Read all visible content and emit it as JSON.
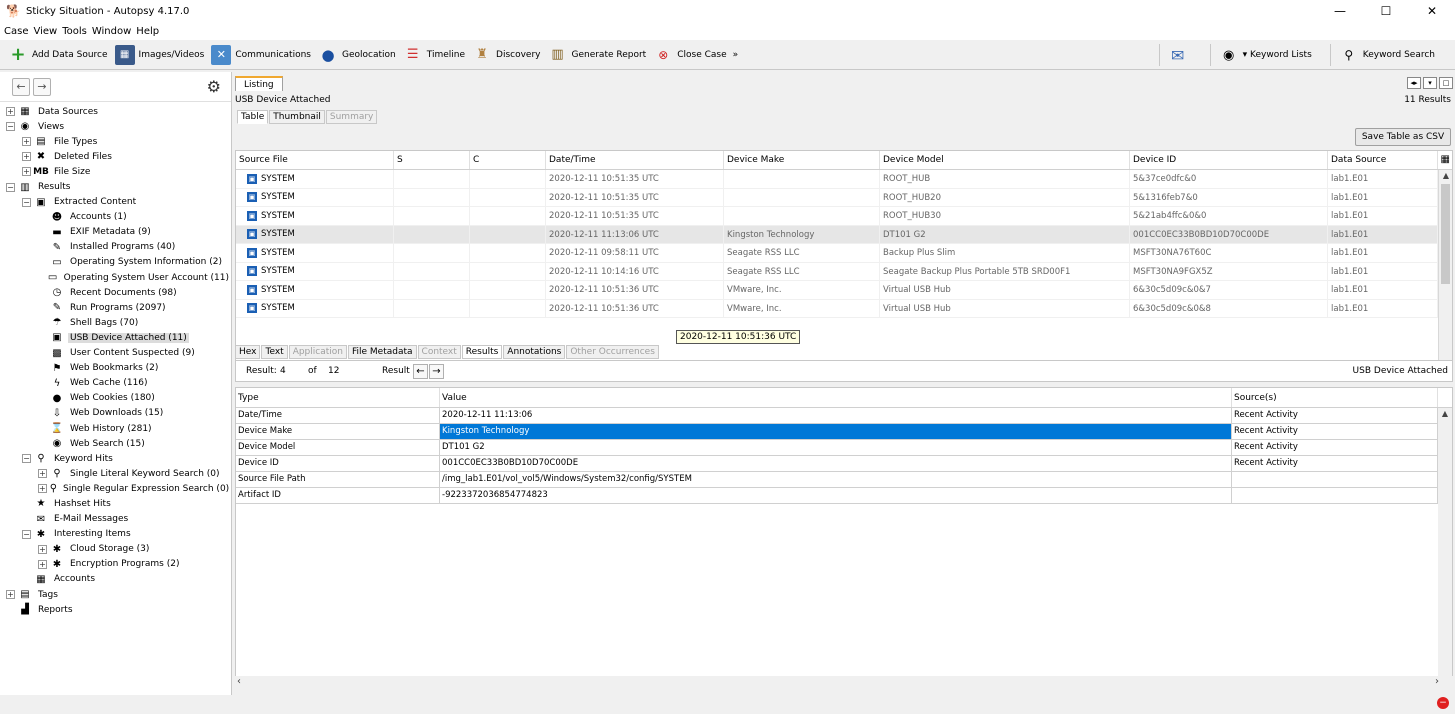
{
  "window": {
    "title": "Sticky Situation - Autopsy 4.17.0",
    "minimize": "—",
    "maximize": "☐",
    "close": "✕"
  },
  "menu": [
    "Case",
    "View",
    "Tools",
    "Window",
    "Help"
  ],
  "toolbar": {
    "add_data_source": "Add Data Source",
    "images_videos": "Images/Videos",
    "communications": "Communications",
    "geolocation": "Geolocation",
    "timeline": "Timeline",
    "discovery": "Discovery",
    "generate_report": "Generate Report",
    "close_case": "Close Case",
    "keyword_lists": "▾ Keyword Lists",
    "keyword_search": "Keyword Search"
  },
  "tree": [
    {
      "label": "Data Sources",
      "depth": 0,
      "exp": "+",
      "icon": "▦"
    },
    {
      "label": "Views",
      "depth": 0,
      "exp": "−",
      "icon": "◉"
    },
    {
      "label": "File Types",
      "depth": 1,
      "exp": "+",
      "icon": "▤"
    },
    {
      "label": "Deleted Files",
      "depth": 1,
      "exp": "+",
      "icon": "✖"
    },
    {
      "label": "File Size",
      "depth": 1,
      "exp": "+",
      "icon": "MB"
    },
    {
      "label": "Results",
      "depth": 0,
      "exp": "−",
      "icon": "▥"
    },
    {
      "label": "Extracted Content",
      "depth": 1,
      "exp": "−",
      "icon": "▣"
    },
    {
      "label": "Accounts (1)",
      "depth": 2,
      "exp": "",
      "icon": "☻"
    },
    {
      "label": "EXIF Metadata (9)",
      "depth": 2,
      "exp": "",
      "icon": "▬"
    },
    {
      "label": "Installed Programs (40)",
      "depth": 2,
      "exp": "",
      "icon": "✎"
    },
    {
      "label": "Operating System Information (2)",
      "depth": 2,
      "exp": "",
      "icon": "▭"
    },
    {
      "label": "Operating System User Account (11)",
      "depth": 2,
      "exp": "",
      "icon": "▭"
    },
    {
      "label": "Recent Documents (98)",
      "depth": 2,
      "exp": "",
      "icon": "◷"
    },
    {
      "label": "Run Programs (2097)",
      "depth": 2,
      "exp": "",
      "icon": "✎"
    },
    {
      "label": "Shell Bags (70)",
      "depth": 2,
      "exp": "",
      "icon": "☂"
    },
    {
      "label": "USB Device Attached (11)",
      "depth": 2,
      "exp": "",
      "icon": "▣",
      "selected": true
    },
    {
      "label": "User Content Suspected (9)",
      "depth": 2,
      "exp": "",
      "icon": "▩"
    },
    {
      "label": "Web Bookmarks (2)",
      "depth": 2,
      "exp": "",
      "icon": "⚑"
    },
    {
      "label": "Web Cache (116)",
      "depth": 2,
      "exp": "",
      "icon": "ϟ"
    },
    {
      "label": "Web Cookies (180)",
      "depth": 2,
      "exp": "",
      "icon": "●"
    },
    {
      "label": "Web Downloads (15)",
      "depth": 2,
      "exp": "",
      "icon": "⇩"
    },
    {
      "label": "Web History (281)",
      "depth": 2,
      "exp": "",
      "icon": "⌛"
    },
    {
      "label": "Web Search (15)",
      "depth": 2,
      "exp": "",
      "icon": "◉"
    },
    {
      "label": "Keyword Hits",
      "depth": 1,
      "exp": "−",
      "icon": "⚲"
    },
    {
      "label": "Single Literal Keyword Search (0)",
      "depth": 2,
      "exp": "+",
      "icon": "⚲"
    },
    {
      "label": "Single Regular Expression Search (0)",
      "depth": 2,
      "exp": "+",
      "icon": "⚲"
    },
    {
      "label": "Hashset Hits",
      "depth": 1,
      "exp": "",
      "icon": "★"
    },
    {
      "label": "E-Mail Messages",
      "depth": 1,
      "exp": "",
      "icon": "✉"
    },
    {
      "label": "Interesting Items",
      "depth": 1,
      "exp": "−",
      "icon": "✱"
    },
    {
      "label": "Cloud Storage (3)",
      "depth": 2,
      "exp": "+",
      "icon": "✱"
    },
    {
      "label": "Encryption Programs (2)",
      "depth": 2,
      "exp": "+",
      "icon": "✱"
    },
    {
      "label": "Accounts",
      "depth": 1,
      "exp": "",
      "icon": "▦"
    },
    {
      "label": "Tags",
      "depth": 0,
      "exp": "+",
      "icon": "▤"
    },
    {
      "label": "Reports",
      "depth": 0,
      "exp": "",
      "icon": "▟"
    }
  ],
  "listing": {
    "tab_label": "Listing",
    "title": "USB Device Attached",
    "count": "11  Results",
    "subtabs": [
      "Table",
      "Thumbnail",
      "Summary"
    ],
    "save_csv": "Save Table as CSV",
    "columns": [
      "Source File",
      "S",
      "C",
      "Date/Time",
      "Device Make",
      "Device Model",
      "Device ID",
      "Data Source"
    ],
    "rows": [
      [
        "SYSTEM",
        "",
        "",
        "2020-12-11 10:51:35 UTC",
        "",
        "ROOT_HUB",
        "5&37ce0dfc&0",
        "lab1.E01"
      ],
      [
        "SYSTEM",
        "",
        "",
        "2020-12-11 10:51:35 UTC",
        "",
        "ROOT_HUB20",
        "5&1316feb7&0",
        "lab1.E01"
      ],
      [
        "SYSTEM",
        "",
        "",
        "2020-12-11 10:51:35 UTC",
        "",
        "ROOT_HUB30",
        "5&21ab4ffc&0&0",
        "lab1.E01"
      ],
      [
        "SYSTEM",
        "",
        "",
        "2020-12-11 11:13:06 UTC",
        "Kingston Technology",
        "DT101 G2",
        "001CC0EC33B0BD10D70C00DE",
        "lab1.E01"
      ],
      [
        "SYSTEM",
        "",
        "",
        "2020-12-11 09:58:11 UTC",
        "Seagate RSS LLC",
        "Backup Plus Slim",
        "MSFT30NA76T60C",
        "lab1.E01"
      ],
      [
        "SYSTEM",
        "",
        "",
        "2020-12-11 10:14:16 UTC",
        "Seagate RSS LLC",
        "Seagate Backup Plus Portable 5TB SRD00F1",
        "MSFT30NA9FGX5Z",
        "lab1.E01"
      ],
      [
        "SYSTEM",
        "",
        "",
        "2020-12-11 10:51:36 UTC",
        "VMware, Inc.",
        "Virtual USB Hub",
        "6&30c5d09c&0&7",
        "lab1.E01"
      ],
      [
        "SYSTEM",
        "",
        "",
        "2020-12-11 10:51:36 UTC",
        "VMware, Inc.",
        "Virtual USB Hub",
        "6&30c5d09c&0&8",
        "lab1.E01"
      ]
    ],
    "selected_row": 3,
    "tooltip": "2020-12-11 10:51:36 UTC"
  },
  "content": {
    "tabs": [
      "Hex",
      "Text",
      "Application",
      "File Metadata",
      "Context",
      "Results",
      "Annotations",
      "Other Occurrences"
    ],
    "disabled_tabs": [
      "Application",
      "Context",
      "Other Occurrences"
    ],
    "active_tab": "Results",
    "result_label": "Result:",
    "result_index": "4",
    "of_label": "of",
    "result_total": "12",
    "result_nav_label": "Result",
    "artifact_type": "USB Device Attached",
    "columns": [
      "Type",
      "Value",
      "Source(s)"
    ],
    "rows": [
      [
        "Date/Time",
        "2020-12-11 11:13:06",
        "Recent Activity"
      ],
      [
        "Device Make",
        "Kingston Technology",
        "Recent Activity"
      ],
      [
        "Device Model",
        "DT101 G2",
        "Recent Activity"
      ],
      [
        "Device ID",
        "001CC0EC33B0BD10D70C00DE",
        "Recent Activity"
      ],
      [
        "Source File Path",
        "/img_lab1.E01/vol_vol5/Windows/System32/config/SYSTEM",
        ""
      ],
      [
        "Artifact ID",
        "-9223372036854774823",
        ""
      ]
    ],
    "highlight_row": 1
  }
}
